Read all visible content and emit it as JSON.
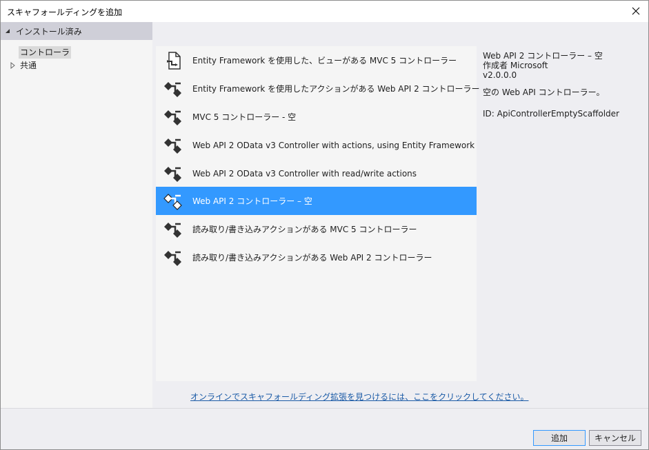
{
  "window": {
    "title": "スキャフォールディングを追加"
  },
  "tree": {
    "header": "インストール済み",
    "items": [
      {
        "label": "コントローラ",
        "selected": true
      },
      {
        "label": "共通",
        "selected": false
      }
    ]
  },
  "list": {
    "items": [
      {
        "label": "Entity Framework を使用した、ビューがある MVC 5 コントローラー",
        "icon": "document-controller-icon"
      },
      {
        "label": "Entity Framework を使用したアクションがある Web API 2 コントローラー",
        "icon": "controller-icon"
      },
      {
        "label": "MVC 5 コントローラー - 空",
        "icon": "controller-icon"
      },
      {
        "label": "Web API 2 OData v3 Controller with actions, using Entity Framework",
        "icon": "controller-icon"
      },
      {
        "label": "Web API 2 OData v3 Controller with read/write actions",
        "icon": "controller-icon"
      },
      {
        "label": "Web API 2 コントローラー – 空",
        "icon": "controller-icon",
        "selected": true
      },
      {
        "label": "読み取り/書き込みアクションがある MVC 5 コントローラー",
        "icon": "controller-icon"
      },
      {
        "label": "読み取り/書き込みアクションがある Web API 2 コントローラー",
        "icon": "controller-icon"
      }
    ]
  },
  "details": {
    "name": "Web API 2 コントローラー – 空",
    "author": "作成者 Microsoft",
    "version": "v2.0.0.0",
    "description": "空の Web API コントローラー。",
    "id": "ID: ApiControllerEmptyScaffolder"
  },
  "online_link": "オンラインでスキャフォールディング拡張を見つけるには、ここをクリックしてください。",
  "buttons": {
    "add": "追加",
    "cancel": "キャンセル"
  },
  "colors": {
    "selection": "#3399ff",
    "link": "#1a5aa6",
    "background": "#eeeef2"
  }
}
